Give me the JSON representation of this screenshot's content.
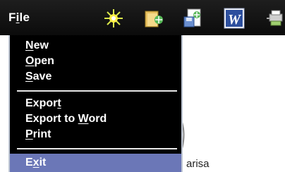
{
  "menubar": {
    "file_label_prefix": "F",
    "file_label_mnemonic": "i",
    "file_label_suffix": "le",
    "toolbar_icons": [
      "sparkle-icon",
      "folder-icon",
      "save-document-icon",
      "word-icon",
      "network-icon"
    ]
  },
  "file_menu": {
    "items": [
      {
        "mnemonic": "N",
        "rest": "ew"
      },
      {
        "mnemonic": "O",
        "rest": "pen"
      },
      {
        "mnemonic": "S",
        "rest": "ave"
      },
      {
        "before": "Expor",
        "mnemonic": "t",
        "after": ""
      },
      {
        "before": "Export to ",
        "mnemonic": "W",
        "after": "ord"
      },
      {
        "before": "",
        "mnemonic": "P",
        "after": "rint"
      },
      {
        "before": "E",
        "mnemonic": "x",
        "after": "it"
      }
    ],
    "selected_item": "Exit"
  },
  "background": {
    "partial_text": "arisa"
  },
  "colors": {
    "menubar": "#111111",
    "menu_bg": "#000000",
    "menu_text": "#ffffff",
    "selected_bg": "#6b77b7",
    "menu_border": "#bfc7d4"
  }
}
